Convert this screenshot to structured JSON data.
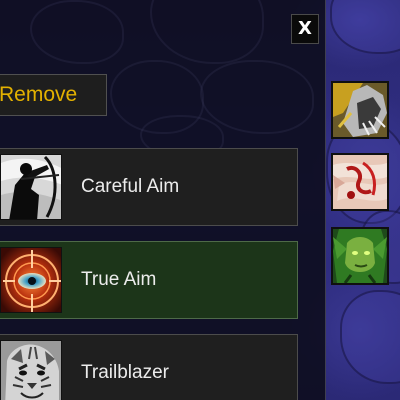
{
  "panel": {
    "close_label": "X",
    "remove_label": "Remove"
  },
  "talents": [
    {
      "label": "Careful Aim",
      "icon": "archer-silhouette-icon",
      "selected": false
    },
    {
      "label": "True Aim",
      "icon": "crosshair-eye-icon",
      "selected": true
    },
    {
      "label": "Trailblazer",
      "icon": "tiger-head-icon",
      "selected": false
    }
  ],
  "side_icons": [
    {
      "icon": "beast-claw-icon"
    },
    {
      "icon": "bloody-bandage-icon"
    },
    {
      "icon": "dryad-portrait-icon"
    }
  ],
  "colors": {
    "remove_text": "#e3b100",
    "selected_row": "#1c3519",
    "row": "#1f1f1f",
    "background": "#2c2a78"
  }
}
